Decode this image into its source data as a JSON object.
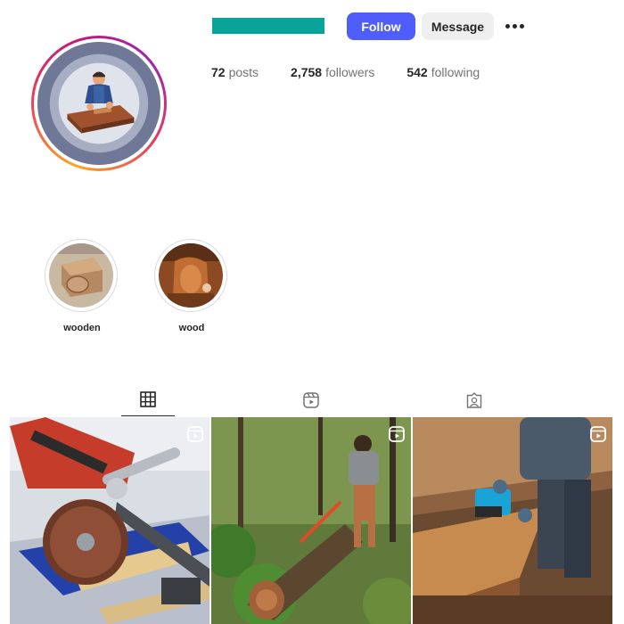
{
  "profile": {
    "avatar_icon": "woodworker-avatar",
    "username_redacted_color": "#0aa39a"
  },
  "actions": {
    "follow_label": "Follow",
    "message_label": "Message",
    "more_icon": "more-horizontal-icon"
  },
  "stats": [
    {
      "value": "72",
      "label": "posts"
    },
    {
      "value": "2,758",
      "label": "followers"
    },
    {
      "value": "542",
      "label": "following"
    }
  ],
  "highlights": [
    {
      "label": "wooden"
    },
    {
      "label": "wood"
    }
  ],
  "tabs": [
    {
      "icon": "grid-icon",
      "active": true
    },
    {
      "icon": "reels-icon",
      "active": false
    },
    {
      "icon": "tagged-icon",
      "active": false
    }
  ],
  "posts": [
    {
      "type": "reel",
      "scene": "angle grinder cutting metal bar on wooden jig"
    },
    {
      "type": "reel",
      "scene": "man cutting log in forest"
    },
    {
      "type": "reel",
      "scene": "man planing wooden beam with electric planer"
    }
  ],
  "colors": {
    "follow_button": "#4f5dfb",
    "message_button": "#efefef",
    "muted_text": "#737373"
  }
}
